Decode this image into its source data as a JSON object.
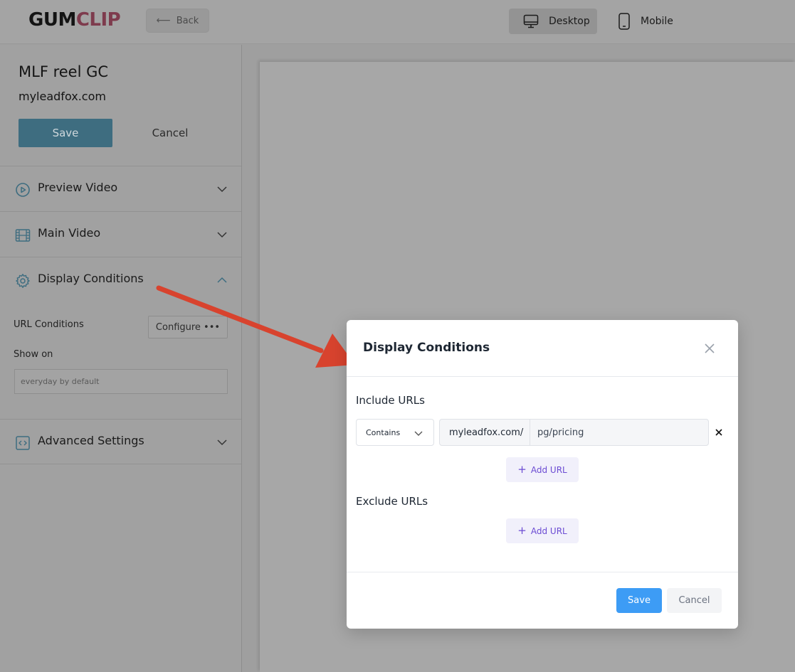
{
  "header": {
    "logo": {
      "part1": "GUM",
      "part2": "CLIP"
    },
    "back_label": "Back",
    "devices": [
      {
        "label": "Desktop",
        "icon": "monitor-icon",
        "active": true
      },
      {
        "label": "Mobile",
        "icon": "phone-icon",
        "active": false
      }
    ]
  },
  "sidebar": {
    "widget_name": "MLF reel GC",
    "domain": "myleadfox.com",
    "save_label": "Save",
    "cancel_label": "Cancel",
    "sections": [
      {
        "label": "Preview Video",
        "icon": "play-circle-icon",
        "expanded": false
      },
      {
        "label": "Main Video",
        "icon": "film-icon",
        "expanded": false
      },
      {
        "label": "Display Conditions",
        "icon": "gear-icon",
        "expanded": true
      },
      {
        "label": "Advanced Settings",
        "icon": "code-icon",
        "expanded": false
      }
    ],
    "display_conditions": {
      "url_conditions_label": "URL Conditions",
      "configure_label": "Configure •••",
      "show_on_label": "Show on",
      "show_on_placeholder": "everyday by default"
    }
  },
  "modal": {
    "title": "Display Conditions",
    "include_label": "Include URLs",
    "exclude_label": "Exclude URLs",
    "include_rules": [
      {
        "match_type": "Contains",
        "prefix": "myleadfox.com/",
        "path": "pg/pricing"
      }
    ],
    "add_url_label": "Add URL",
    "save_label": "Save",
    "cancel_label": "Cancel"
  },
  "colors": {
    "arrow": "#d8432e",
    "primary": "#3d9cf5",
    "accent": "#6b4bd3",
    "sidebar_save": "#3e6d80",
    "logo_clip": "#7e3b4d"
  }
}
